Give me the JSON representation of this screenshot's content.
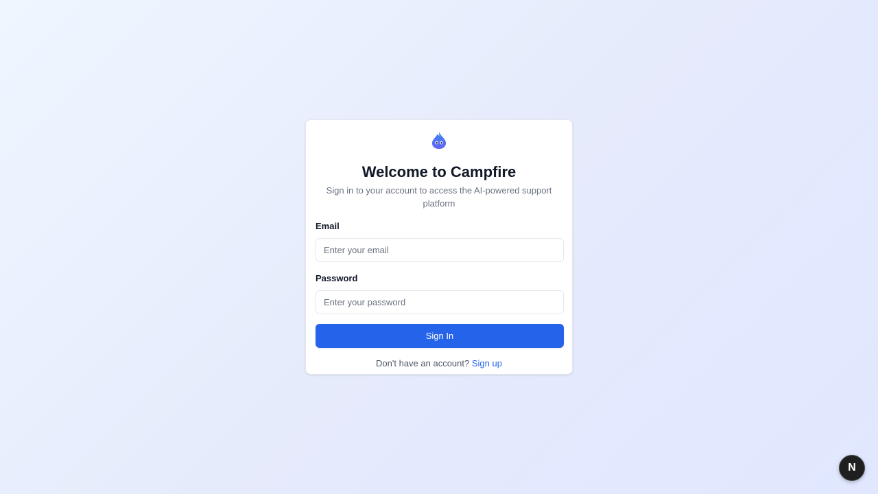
{
  "app": {
    "logo_icon": "campfire-flame-icon"
  },
  "login": {
    "title": "Welcome to Campfire",
    "subtitle": "Sign in to your account to access the AI-powered support platform",
    "email": {
      "label": "Email",
      "placeholder": "Enter your email",
      "value": ""
    },
    "password": {
      "label": "Password",
      "placeholder": "Enter your password",
      "value": ""
    },
    "submit_label": "Sign In",
    "footer_text": "Don't have an account?",
    "signup_label": "Sign up"
  },
  "dev_badge": {
    "label": "N",
    "icon": "nextjs-logo-icon"
  },
  "colors": {
    "primary": "#2563eb",
    "title": "#111827",
    "muted": "#6b7280",
    "card_bg": "#ffffff",
    "border": "#e5e7eb"
  }
}
